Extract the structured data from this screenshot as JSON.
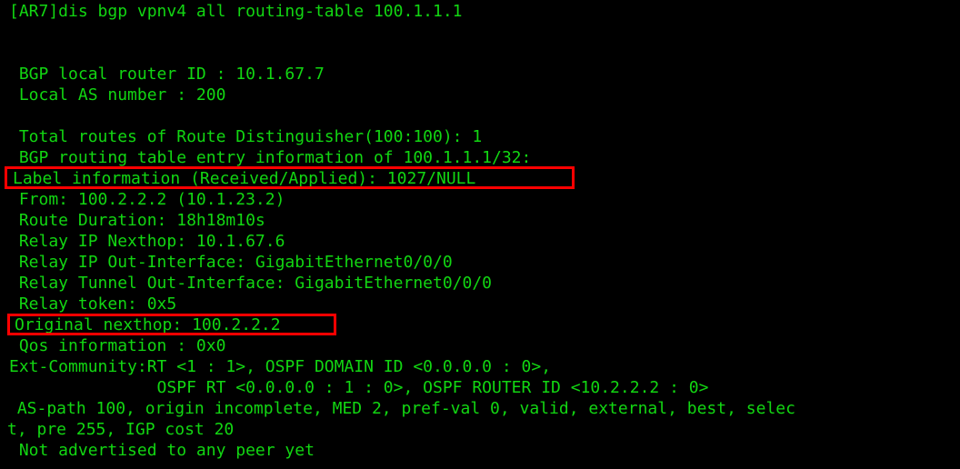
{
  "terminal": {
    "background_color": "#000000",
    "text_color": "#12d612",
    "highlight_color": "#ff0000",
    "prompt_device": "[AR7]",
    "command": "[AR7]dis bgp vpnv4 all routing-table 100.1.1.1",
    "lines": {
      "command": "[AR7]dis bgp vpnv4 all routing-table 100.1.1.1",
      "bgp_local_router_id": " BGP local router ID : 10.1.67.7",
      "local_as_number": " Local AS number : 200",
      "total_routes": " Total routes of Route Distinguisher(100:100): 1",
      "bgp_routing_table_entry": " BGP routing table entry information of 100.1.1.1/32:",
      "label_information": "Label information (Received/Applied): 1027/NULL",
      "from": " From: 100.2.2.2 (10.1.23.2)",
      "route_duration": " Route Duration: 18h18m10s",
      "relay_ip_nexthop": " Relay IP Nexthop: 10.1.67.6",
      "relay_ip_out_interface": " Relay IP Out-Interface: GigabitEthernet0/0/0",
      "relay_tunnel_out_interface": " Relay Tunnel Out-Interface: GigabitEthernet0/0/0",
      "relay_token": " Relay token: 0x5",
      "original_nexthop": "Original nexthop: 100.2.2.2",
      "qos_information": " Qos information : 0x0",
      "ext_community": "Ext-Community:RT <1 : 1>, OSPF DOMAIN ID <0.0.0.0 : 0>,",
      "ext_community_cont": "               OSPF RT <0.0.0.0 : 1 : 0>, OSPF ROUTER ID <10.2.2.2 : 0>",
      "as_path": " AS-path 100, origin incomplete, MED 2, pref-val 0, valid, external, best, selec",
      "as_path_cont": "t, pre 255, IGP cost 20",
      "not_advertised": " Not advertised to any peer yet"
    },
    "highlights": [
      {
        "name": "label-information-highlight",
        "target": "label_information"
      },
      {
        "name": "original-nexthop-highlight",
        "target": "original_nexthop"
      }
    ],
    "values": {
      "bgp_local_router_id": "10.1.67.7",
      "local_as_number": "200",
      "route_distinguisher": "100:100",
      "total_routes": "1",
      "prefix": "100.1.1.1/32",
      "label_received": "1027",
      "label_applied": "NULL",
      "from_peer": "100.2.2.2",
      "from_peer_router_id": "10.1.23.2",
      "route_duration": "18h18m10s",
      "relay_ip_nexthop": "10.1.67.6",
      "relay_ip_out_interface": "GigabitEthernet0/0/0",
      "relay_tunnel_out_interface": "GigabitEthernet0/0/0",
      "relay_token": "0x5",
      "original_nexthop": "100.2.2.2",
      "qos_information": "0x0",
      "ext_community_rt": "<1 : 1>",
      "ospf_domain_id": "<0.0.0.0 : 0>",
      "ospf_rt": "<0.0.0.0 : 1 : 0>",
      "ospf_router_id": "<10.2.2.2 : 0>",
      "as_path": "100",
      "origin": "incomplete",
      "med": "2",
      "pref_val": "0",
      "preference": "255",
      "igp_cost": "20",
      "flags": "valid, external, best, select",
      "advertisement_status": "Not advertised to any peer yet"
    }
  }
}
